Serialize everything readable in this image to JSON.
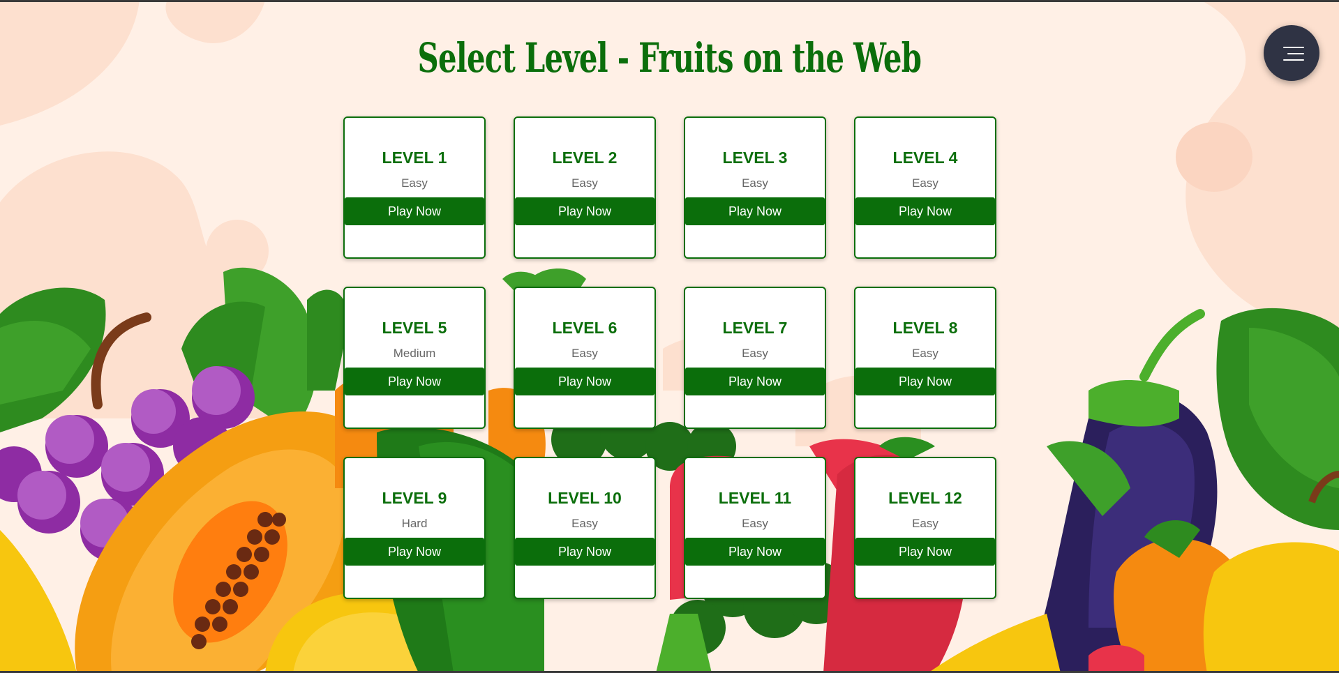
{
  "title": "Select Level - Fruits on the Web",
  "menu": {
    "icon": "hamburger-menu-icon"
  },
  "colors": {
    "accent": "#0b6e0b",
    "background": "#fff0e6",
    "menu_button": "#2f3344",
    "difficulty_text": "#666666"
  },
  "levels": [
    {
      "label": "LEVEL 1",
      "difficulty": "Easy",
      "button": "Play Now"
    },
    {
      "label": "LEVEL 2",
      "difficulty": "Easy",
      "button": "Play Now"
    },
    {
      "label": "LEVEL 3",
      "difficulty": "Easy",
      "button": "Play Now"
    },
    {
      "label": "LEVEL 4",
      "difficulty": "Easy",
      "button": "Play Now"
    },
    {
      "label": "LEVEL 5",
      "difficulty": "Medium",
      "button": "Play Now"
    },
    {
      "label": "LEVEL 6",
      "difficulty": "Easy",
      "button": "Play Now"
    },
    {
      "label": "LEVEL 7",
      "difficulty": "Easy",
      "button": "Play Now"
    },
    {
      "label": "LEVEL 8",
      "difficulty": "Easy",
      "button": "Play Now"
    },
    {
      "label": "LEVEL 9",
      "difficulty": "Hard",
      "button": "Play Now"
    },
    {
      "label": "LEVEL 10",
      "difficulty": "Easy",
      "button": "Play Now"
    },
    {
      "label": "LEVEL 11",
      "difficulty": "Easy",
      "button": "Play Now"
    },
    {
      "label": "LEVEL 12",
      "difficulty": "Easy",
      "button": "Play Now"
    }
  ]
}
